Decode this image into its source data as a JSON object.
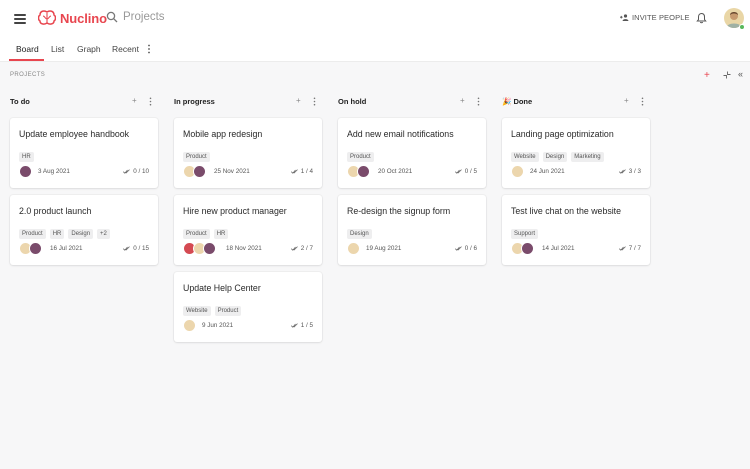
{
  "app": {
    "name": "Nuclino",
    "search_placeholder": "Projects",
    "invite_label": "INVITE PEOPLE"
  },
  "tabs": [
    {
      "label": "Board"
    },
    {
      "label": "List"
    },
    {
      "label": "Graph"
    },
    {
      "label": "Recent"
    }
  ],
  "board": {
    "section_label": "PROJECTS",
    "columns": [
      {
        "title": "To do",
        "cards": [
          {
            "title": "Update employee handbook",
            "tags": [
              "HR"
            ],
            "date": "3 Aug 2021",
            "checks": "0 / 10"
          },
          {
            "title": "2.0 product launch",
            "tags": [
              "Product",
              "HR",
              "Design",
              "+2"
            ],
            "date": "16 Jul 2021",
            "checks": "0 / 15"
          }
        ]
      },
      {
        "title": "In progress",
        "cards": [
          {
            "title": "Mobile app redesign",
            "tags": [
              "Product"
            ],
            "date": "25 Nov 2021",
            "checks": "1 / 4"
          },
          {
            "title": "Hire new product manager",
            "tags": [
              "Product",
              "HR"
            ],
            "date": "18 Nov 2021",
            "checks": "2 / 7"
          },
          {
            "title": "Update Help Center",
            "tags": [
              "Website",
              "Product"
            ],
            "date": "9 Jun 2021",
            "checks": "1 / 5"
          }
        ]
      },
      {
        "title": "On hold",
        "cards": [
          {
            "title": "Add new email notifications",
            "tags": [
              "Product"
            ],
            "date": "20 Oct 2021",
            "checks": "0 / 5"
          },
          {
            "title": "Re-design the signup form",
            "tags": [
              "Design"
            ],
            "date": "19 Aug 2021",
            "checks": "0 / 6"
          }
        ]
      },
      {
        "title": "Done",
        "emoji": "🎉",
        "cards": [
          {
            "title": "Landing page optimization",
            "tags": [
              "Website",
              "Design",
              "Marketing"
            ],
            "date": "24 Jun 2021",
            "checks": "3 / 3"
          },
          {
            "title": "Test live chat on the website",
            "tags": [
              "Support"
            ],
            "date": "14 Jul 2021",
            "checks": "7 / 7"
          }
        ]
      }
    ]
  },
  "colors": {
    "accent": "#e8464f",
    "tag_bg": "#eeeeef",
    "online": "#58b85c"
  }
}
